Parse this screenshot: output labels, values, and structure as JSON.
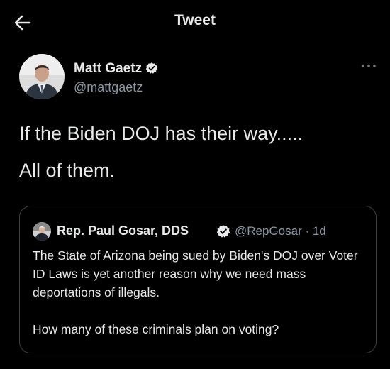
{
  "header": {
    "back_icon": "arrow-left-icon",
    "title": "Tweet"
  },
  "author": {
    "name": "Matt Gaetz",
    "handle": "@mattgaetz",
    "verified": true,
    "more_icon": "more-horizontal-icon"
  },
  "tweet": {
    "line1": "If the Biden DOJ has their way.....",
    "line2": "All of them."
  },
  "quote": {
    "name": "Rep. Paul Gosar, DDS",
    "verified": true,
    "handle_time": "@RepGosar · 1d",
    "text": "The State of Arizona being sued by Biden's DOJ over Voter ID Laws is yet another reason why we need mass deportations of illegals.\n\nHow many of these criminals plan on voting?"
  },
  "colors": {
    "background": "#000000",
    "text_primary": "#e7e9ea",
    "text_secondary": "#8b98a5",
    "border": "#3e4144"
  }
}
